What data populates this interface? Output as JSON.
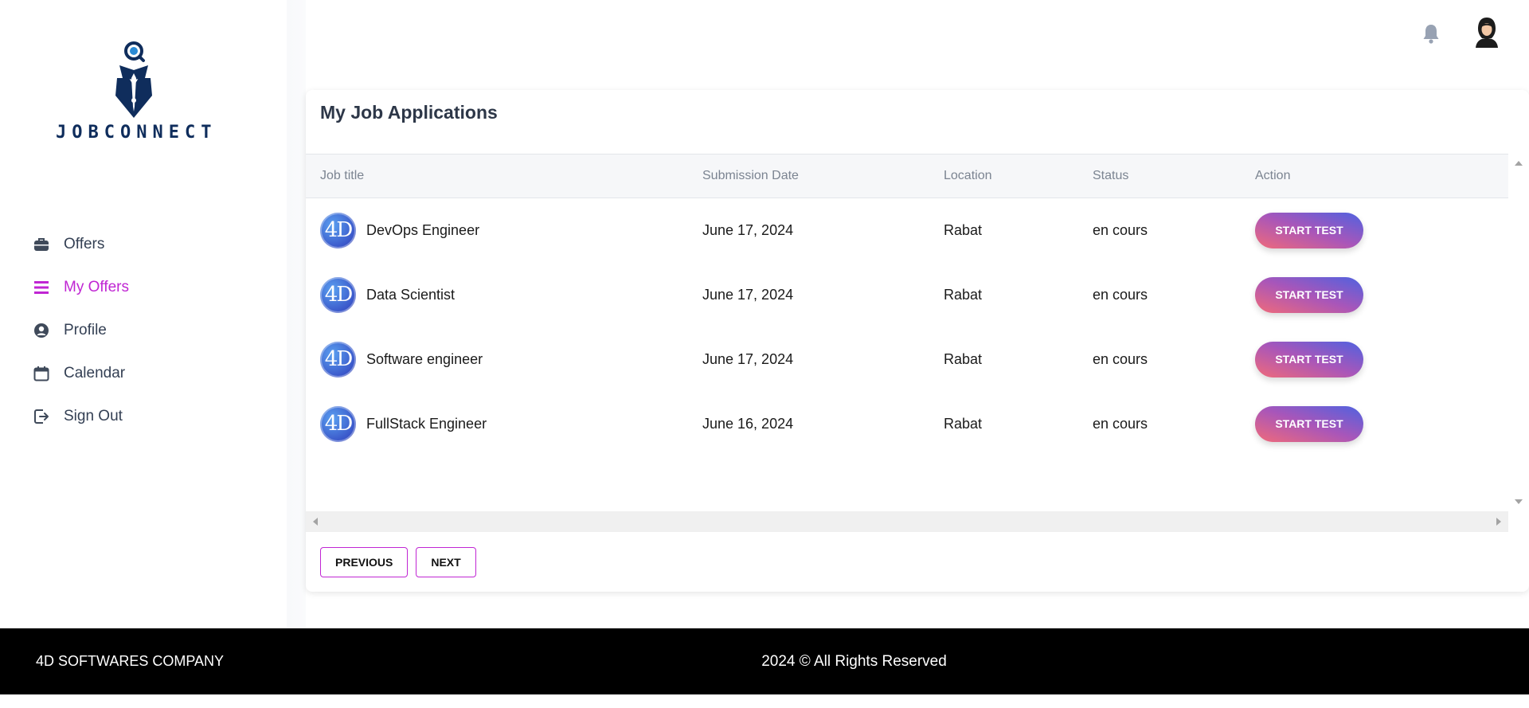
{
  "brand": {
    "name": "JOBCONNECT"
  },
  "sidebar": {
    "items": [
      {
        "label": "Offers",
        "icon": "briefcase-icon",
        "active": false
      },
      {
        "label": "My Offers",
        "icon": "list-icon",
        "active": true
      },
      {
        "label": "Profile",
        "icon": "user-circle-icon",
        "active": false
      },
      {
        "label": "Calendar",
        "icon": "calendar-icon",
        "active": false
      },
      {
        "label": "Sign Out",
        "icon": "sign-out-icon",
        "active": false
      }
    ]
  },
  "topbar": {
    "notification_icon": "bell-icon",
    "avatar_icon": "avatar-icon"
  },
  "main": {
    "title": "My Job Applications",
    "table": {
      "columns": [
        "Job title",
        "Submission Date",
        "Location",
        "Status",
        "Action"
      ],
      "rows": [
        {
          "logo": "4D",
          "job_title": "DevOps Engineer",
          "date": "June 17, 2024",
          "location": "Rabat",
          "status": "en cours",
          "action": "START TEST"
        },
        {
          "logo": "4D",
          "job_title": "Data Scientist",
          "date": "June 17, 2024",
          "location": "Rabat",
          "status": "en cours",
          "action": "START TEST"
        },
        {
          "logo": "4D",
          "job_title": "Software engineer",
          "date": "June 17, 2024",
          "location": "Rabat",
          "status": "en cours",
          "action": "START TEST"
        },
        {
          "logo": "4D",
          "job_title": "FullStack Engineer",
          "date": "June 16, 2024",
          "location": "Rabat",
          "status": "en cours",
          "action": "START TEST"
        }
      ]
    },
    "pagination": {
      "previous": "PREVIOUS",
      "next": "NEXT"
    }
  },
  "footer": {
    "company": "4D SOFTWARES COMPANY",
    "copyright": "2024 © All Rights Reserved"
  },
  "colors": {
    "accent": "#c026d3",
    "brand_navy": "#0f2d5c",
    "button_gradient_start": "#f06a7a",
    "button_gradient_end": "#4f62e0"
  }
}
